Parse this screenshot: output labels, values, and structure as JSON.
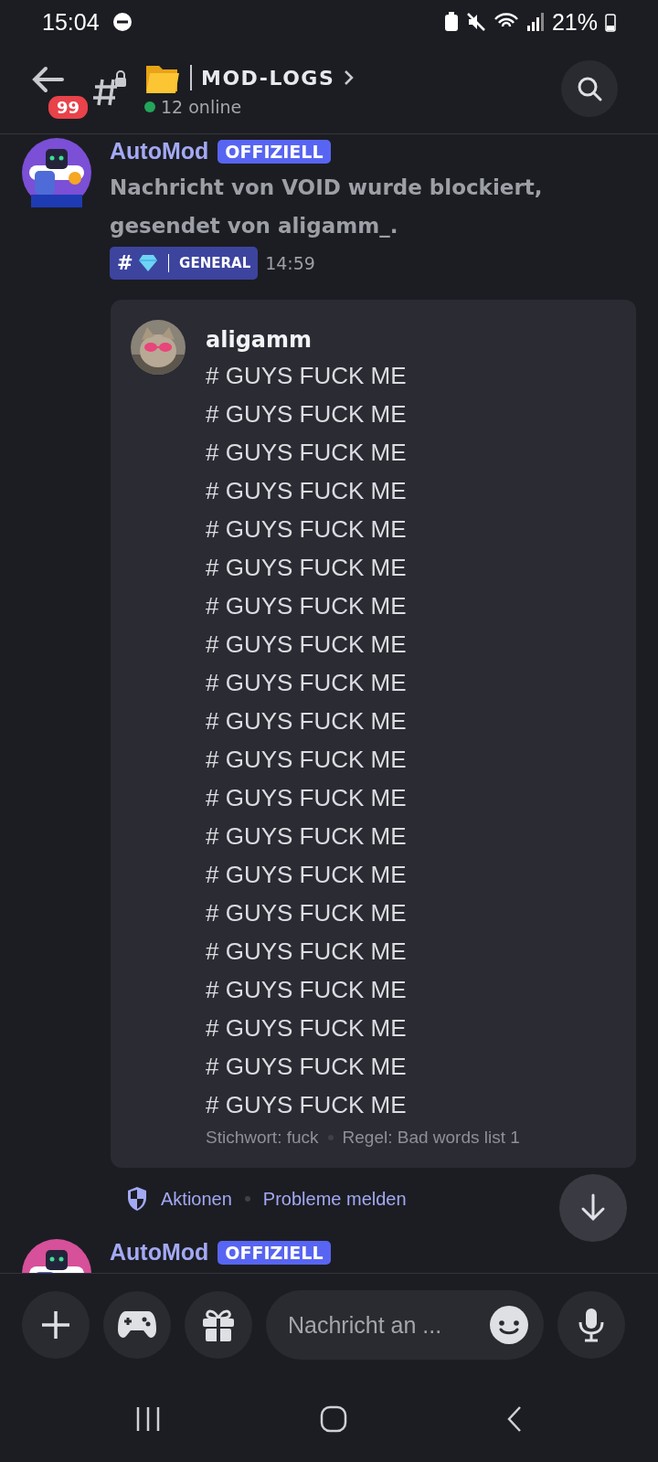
{
  "status_bar": {
    "time": "15:04",
    "battery": "21%"
  },
  "header": {
    "unread_badge": "99",
    "channel_name": "MOD-LOGS",
    "online_count": "12 online"
  },
  "messages": [
    {
      "kind": "blocked",
      "author": "AutoMod",
      "tag": "OFFIZIELL",
      "text": "Nachricht von VOID wurde blockiert, gesendet von aligamm_.",
      "channel_chip_hash": "#",
      "channel_chip": "GENERAL",
      "time": "14:59",
      "embed": {
        "author": "aligamm",
        "lines": [
          "# GUYS FUCK ME",
          "# GUYS FUCK ME",
          "# GUYS FUCK ME",
          "# GUYS FUCK ME",
          "# GUYS FUCK ME",
          "# GUYS FUCK ME",
          "# GUYS FUCK ME",
          "# GUYS FUCK ME",
          "# GUYS FUCK ME",
          "# GUYS FUCK ME",
          "# GUYS FUCK ME",
          "# GUYS FUCK ME",
          "# GUYS FUCK ME",
          "# GUYS FUCK ME",
          "# GUYS FUCK ME",
          "# GUYS FUCK ME",
          "# GUYS FUCK ME",
          "# GUYS FUCK ME",
          "# GUYS FUCK ME",
          "# GUYS FUCK ME"
        ],
        "keyword": "Stichwort: fuck",
        "rule": "Regel: Bad words list 1"
      },
      "actions": [
        "Aktionen",
        "Probleme melden"
      ]
    },
    {
      "kind": "header_only",
      "author": "AutoMod",
      "tag": "OFFIZIELL"
    }
  ],
  "composer": {
    "placeholder": "Nachricht an ..."
  }
}
